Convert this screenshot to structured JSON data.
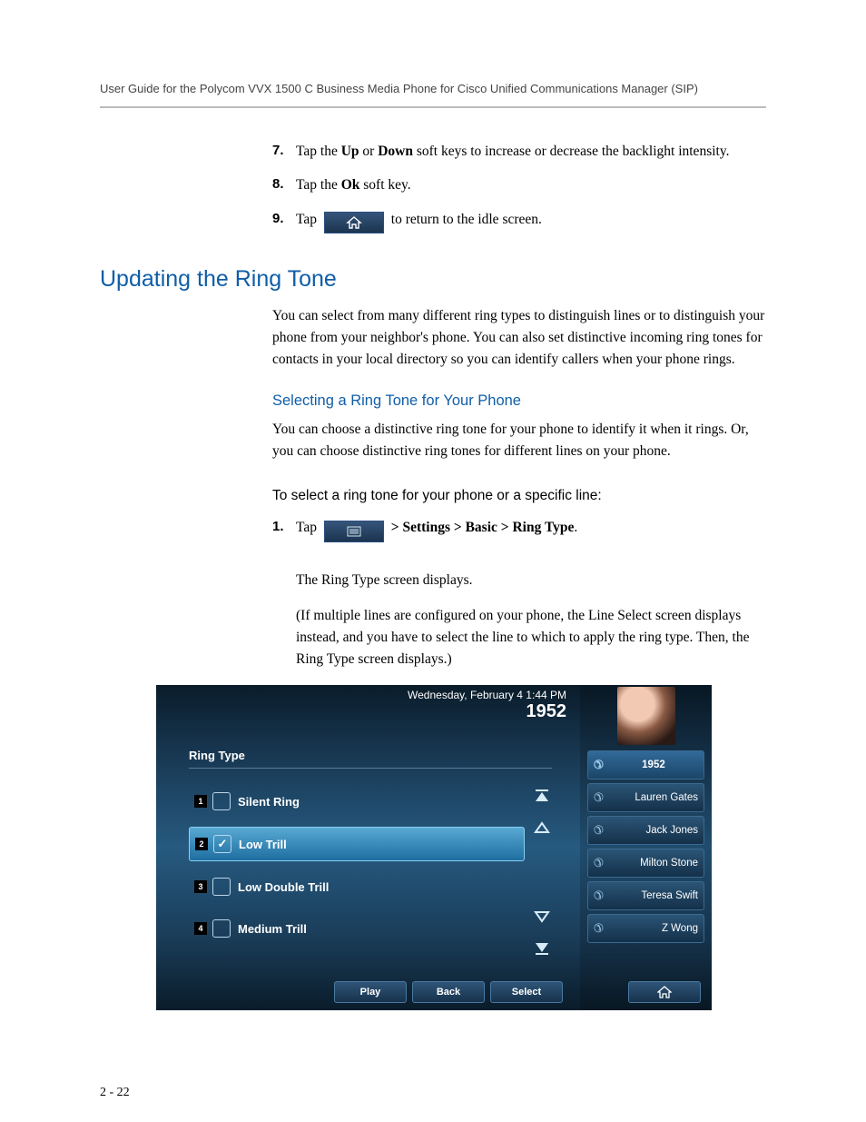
{
  "header": "User Guide for the Polycom VVX 1500 C Business Media Phone for Cisco Unified Communications Manager (SIP)",
  "steps": {
    "s7_pre": "Tap the ",
    "s7_up": "Up",
    "s7_mid": " or ",
    "s7_down": "Down",
    "s7_post": " soft keys to increase or decrease the backlight intensity.",
    "s8_pre": "Tap the ",
    "s8_ok": "Ok",
    "s8_post": " soft key.",
    "s9_pre": "Tap ",
    "s9_post": " to return to the idle screen."
  },
  "section_title": "Updating the Ring Tone",
  "section_para": "You can select from many different ring types to distinguish lines or to distinguish your phone from your neighbor's phone. You can also set distinctive incoming ring tones for contacts in your local directory so you can identify callers when your phone rings.",
  "sub_title": "Selecting a Ring Tone for Your Phone",
  "sub_para": "You can choose a distinctive ring tone for your phone to identify it when it rings. Or, you can choose distinctive ring tones for different lines on your phone.",
  "proc_title": "To select a ring tone for your phone or a specific line:",
  "proc": {
    "s1_pre": "Tap ",
    "s1_path": "  > Settings > Basic > Ring Type",
    "s1_end": ".",
    "p1": "The Ring Type screen displays.",
    "p2": "(If multiple lines are configured on your phone, the Line Select screen displays instead, and you have to select the line to which to apply the ring type. Then, the Ring Type screen displays.)"
  },
  "phone": {
    "date": "Wednesday, February 4  1:44 PM",
    "ext": "1952",
    "list_title": "Ring Type",
    "items": [
      {
        "n": "1",
        "label": "Silent Ring",
        "checked": false
      },
      {
        "n": "2",
        "label": "Low Trill",
        "checked": true
      },
      {
        "n": "3",
        "label": "Low Double Trill",
        "checked": false
      },
      {
        "n": "4",
        "label": "Medium Trill",
        "checked": false
      }
    ],
    "contacts": [
      "1952",
      "Lauren Gates",
      "Jack Jones",
      "Milton Stone",
      "Teresa Swift",
      "Z Wong"
    ],
    "softkeys": [
      "Play",
      "Back",
      "Select"
    ]
  },
  "pagenum": "2 - 22"
}
